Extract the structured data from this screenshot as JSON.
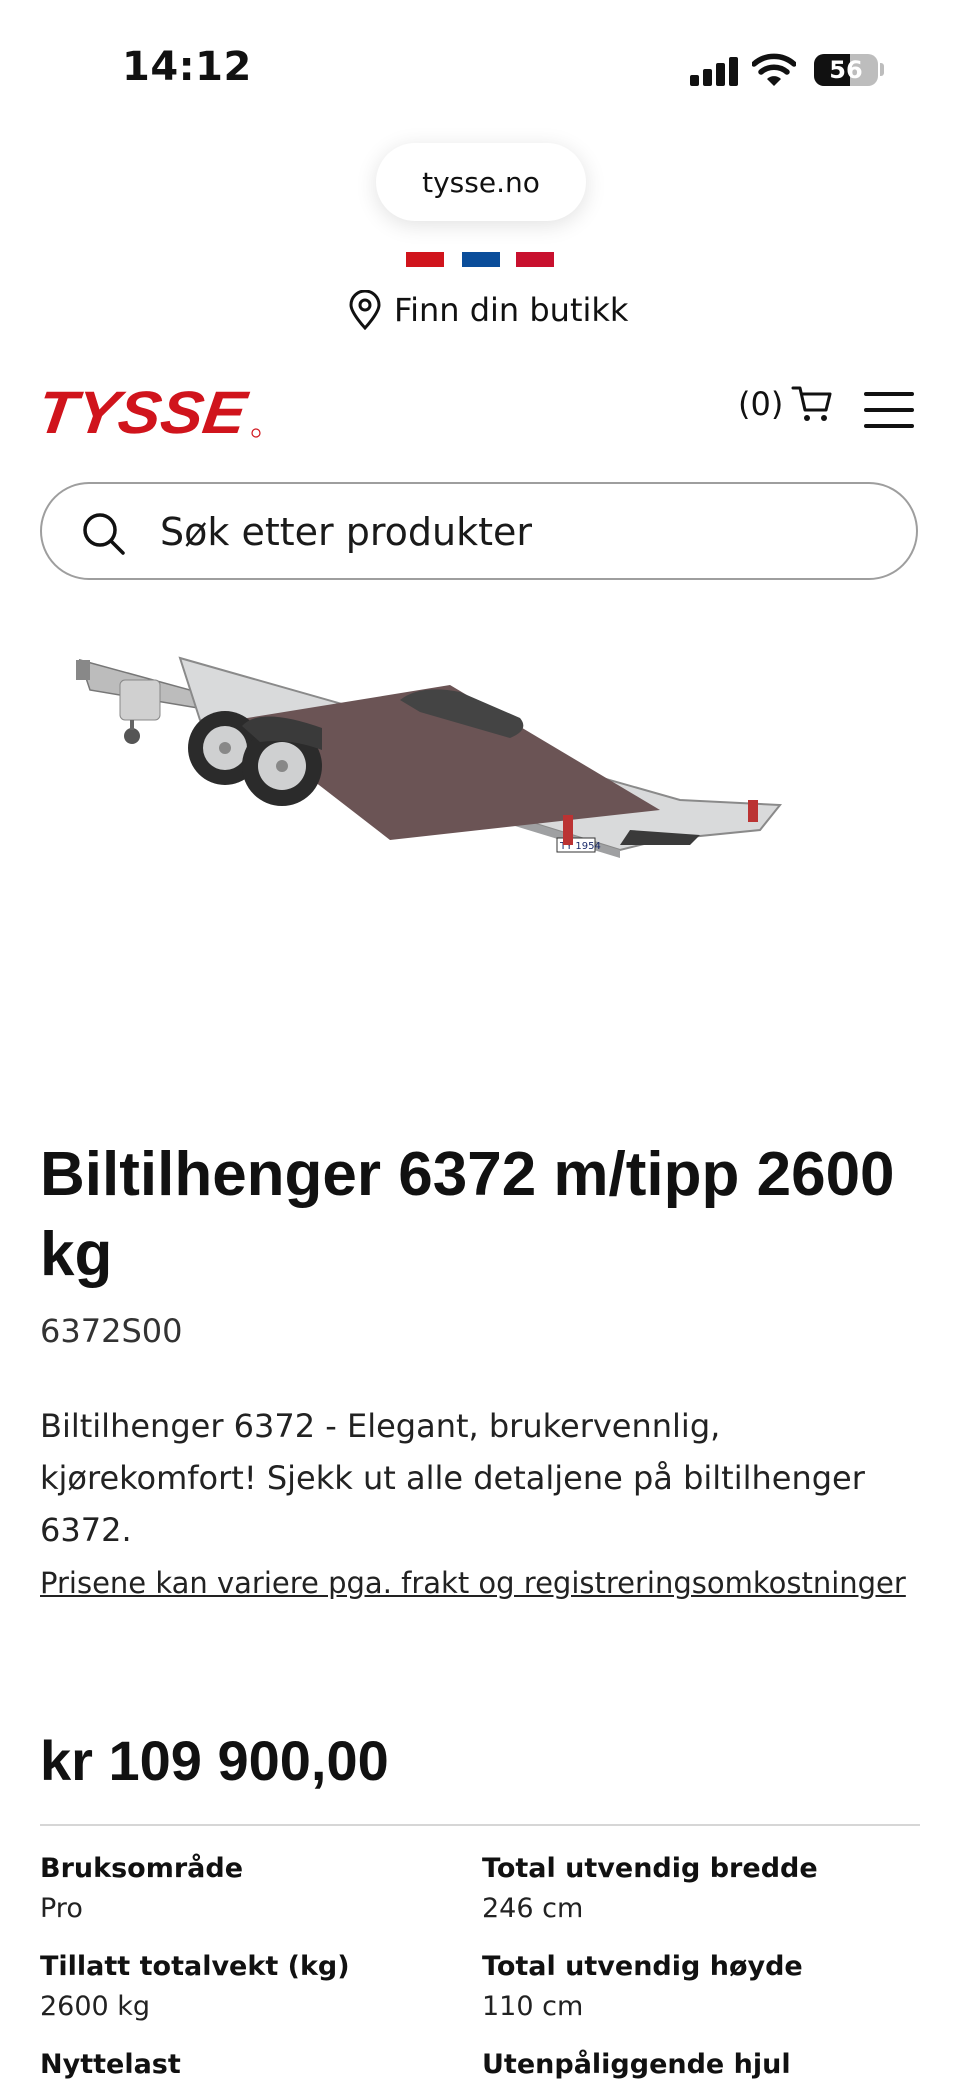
{
  "status_bar": {
    "time": "14:12",
    "battery": "56"
  },
  "browser": {
    "url": "tysse.no"
  },
  "store_finder": {
    "label": "Finn din butikk"
  },
  "header": {
    "brand": "TYSSE",
    "cart_count": "(0)"
  },
  "search": {
    "placeholder": "Søk etter produkter"
  },
  "product": {
    "title": "Biltilhenger 6372 m/tipp 2600kg",
    "sku": "6372S00",
    "description": "Biltilhenger 6372 - Elegant, brukervennlig, kjørekomfort! Sjekk ut alle detaljene på biltilhenger 6372.",
    "price_note": "Prisene kan variere pga. frakt og registreringsomkostninger",
    "price": "kr 109 900,00",
    "image_plate": "TY 1954",
    "specs": [
      {
        "label": "Bruksområde",
        "value": "Pro"
      },
      {
        "label": "Total utvendig bredde",
        "value": "246 cm"
      },
      {
        "label": "Tillatt totalvekt (kg)",
        "value": "2600 kg"
      },
      {
        "label": "Total utvendig høyde",
        "value": "110 cm"
      },
      {
        "label": "Nyttelast",
        "value": ""
      },
      {
        "label": "Utenpåliggende hjul",
        "value": ""
      }
    ]
  },
  "colors": {
    "brand_red": "#d0141c",
    "flag_blue": "#0a4d9a",
    "text": "#111111"
  }
}
